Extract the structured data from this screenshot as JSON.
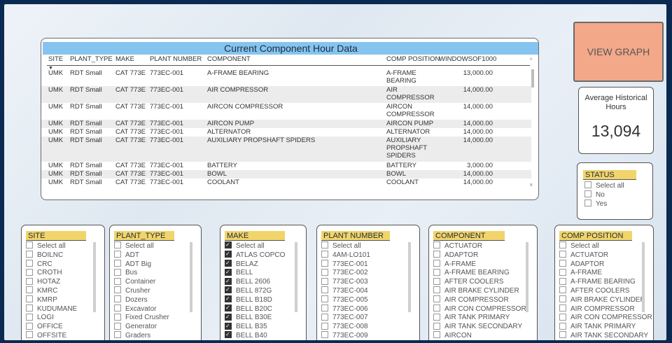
{
  "table": {
    "title": "Current Component Hour Data",
    "columns": [
      "SITE",
      "PLANT_TYPE",
      "MAKE",
      "PLANT NUMBER",
      "COMPONENT",
      "COMP POSITION",
      "WINDOWSOF1000"
    ],
    "rows": [
      [
        "UMK",
        "RDT Small",
        "CAT 773E",
        "773EC-001",
        "A-FRAME BEARING",
        "A-FRAME BEARING",
        "13,000.00"
      ],
      [
        "UMK",
        "RDT Small",
        "CAT 773E",
        "773EC-001",
        "AIR COMPRESSOR",
        "AIR COMPRESSOR",
        "14,000.00"
      ],
      [
        "UMK",
        "RDT Small",
        "CAT 773E",
        "773EC-001",
        "AIRCON COMPRESSOR",
        "AIRCON COMPRESSOR",
        "14,000.00"
      ],
      [
        "UMK",
        "RDT Small",
        "CAT 773E",
        "773EC-001",
        "AIRCON PUMP",
        "AIRCON PUMP",
        "14,000.00"
      ],
      [
        "UMK",
        "RDT Small",
        "CAT 773E",
        "773EC-001",
        "ALTERNATOR",
        "ALTERNATOR",
        "14,000.00"
      ],
      [
        "UMK",
        "RDT Small",
        "CAT 773E",
        "773EC-001",
        "AUXILIARY PROPSHAFT SPIDERS",
        "AUXILIARY PROPSHAFT SPIDERS",
        "14,000.00"
      ],
      [
        "UMK",
        "RDT Small",
        "CAT 773E",
        "773EC-001",
        "BATTERY",
        "BATTERY",
        "3,000.00"
      ],
      [
        "UMK",
        "RDT Small",
        "CAT 773E",
        "773EC-001",
        "BOWL",
        "BOWL",
        "14,000.00"
      ],
      [
        "UMK",
        "RDT Small",
        "CAT 773E",
        "773EC-001",
        "COOLANT",
        "COOLANT",
        "14,000.00"
      ]
    ]
  },
  "view_graph_label": "VIEW GRAPH",
  "average": {
    "title": "Average Historical Hours",
    "value": "13,094"
  },
  "status": {
    "title": "STATUS",
    "options": [
      "Select all",
      "No",
      "Yes"
    ]
  },
  "slicers": [
    {
      "title": "SITE",
      "options": [
        "Select all",
        "BOILNC",
        "CRC",
        "CROTH",
        "HOTAZ",
        "KMRC",
        "KMRP",
        "KUDUMANE",
        "LOGI",
        "OFFICE",
        "OFFSITE"
      ],
      "checked": []
    },
    {
      "title": "PLANT_TYPE",
      "options": [
        "Select all",
        "ADT",
        "ADT Big",
        "Bus",
        "Container",
        "Crusher",
        "Dozers",
        "Excavator",
        "Fixed Crusher",
        "Generator",
        "Graders"
      ],
      "checked": []
    },
    {
      "title": "MAKE",
      "options": [
        "Select all",
        "ATLAS COPCO",
        "BELAZ",
        "BELL",
        "BELL 2606",
        "BELL 872G",
        "BELL B18D",
        "BELL B20C",
        "BELL B30E",
        "BELL B35",
        "BELL B40"
      ],
      "checked": [
        0,
        1,
        2,
        3,
        4,
        5,
        6,
        7,
        8,
        9,
        10
      ]
    },
    {
      "title": "PLANT NUMBER",
      "options": [
        "Select all",
        "4AM-LO101",
        "773EC-001",
        "773EC-002",
        "773EC-003",
        "773EC-004",
        "773EC-005",
        "773EC-006",
        "773EC-007",
        "773EC-008",
        "773EC-009"
      ],
      "checked": []
    },
    {
      "title": "COMPONENT",
      "options": [
        "ACTUATOR",
        "ADAPTOR",
        "A-FRAME",
        "A-FRAME BEARING",
        "AFTER COOLERS",
        "AIR BRAKE CYLINDER",
        "AIR COMPRESSOR",
        "AIR CON COMPRESSOR",
        "AIR TANK PRIMARY",
        "AIR TANK SECONDARY",
        "AIRCON"
      ],
      "checked": []
    },
    {
      "title": "COMP POSITION",
      "options": [
        "Select all",
        "ACTUATOR",
        "ADAPTOR",
        "A-FRAME",
        "A-FRAME BEARING",
        "AFTER COOLERS",
        "AIR BRAKE CYLINDER",
        "AIR COMPRESSOR",
        "AIR CON COMPRESSOR",
        "AIR TANK PRIMARY",
        "AIR TANK SECONDARY"
      ],
      "checked": []
    }
  ]
}
